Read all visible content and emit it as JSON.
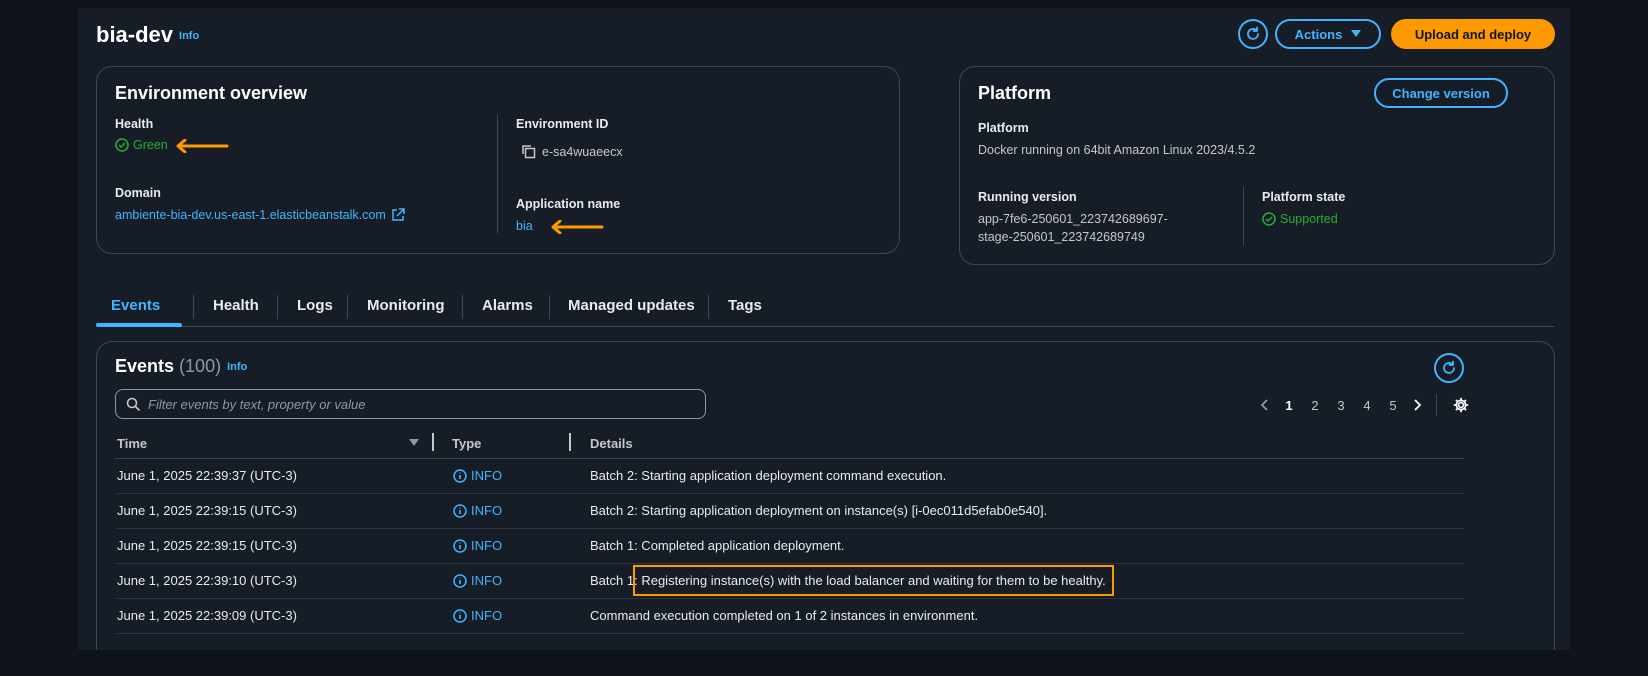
{
  "header": {
    "title": "bia-dev",
    "info": "Info",
    "actions_label": "Actions",
    "upload_label": "Upload and deploy"
  },
  "overview": {
    "title": "Environment overview",
    "health_label": "Health",
    "health_value": "Green",
    "domain_label": "Domain",
    "domain_value": "ambiente-bia-dev.us-east-1.elasticbeanstalk.com",
    "env_id_label": "Environment ID",
    "env_id_value": "e-sa4wuaeecx",
    "app_name_label": "Application name",
    "app_name_value": "bia"
  },
  "platform": {
    "title": "Platform",
    "change_version_label": "Change version",
    "platform_label": "Platform",
    "platform_value": "Docker running on 64bit Amazon Linux 2023/4.5.2",
    "running_version_label": "Running version",
    "running_version_line1": "app-7fe6-250601_223742689697-",
    "running_version_line2": "stage-250601_223742689749",
    "state_label": "Platform state",
    "state_value": "Supported"
  },
  "tabs": [
    "Events",
    "Health",
    "Logs",
    "Monitoring",
    "Alarms",
    "Managed updates",
    "Tags"
  ],
  "events": {
    "title": "Events",
    "count": "(100)",
    "info": "Info",
    "search_placeholder": "Filter events by text, property or value",
    "pages": [
      "1",
      "2",
      "3",
      "4",
      "5"
    ],
    "columns": {
      "time": "Time",
      "type": "Type",
      "details": "Details"
    },
    "rows": [
      {
        "time": "June 1, 2025 22:39:37 (UTC-3)",
        "type": "INFO",
        "details": "Batch 2: Starting application deployment command execution."
      },
      {
        "time": "June 1, 2025 22:39:15 (UTC-3)",
        "type": "INFO",
        "details": "Batch 2: Starting application deployment on instance(s) [i-0ec011d5efab0e540]."
      },
      {
        "time": "June 1, 2025 22:39:15 (UTC-3)",
        "type": "INFO",
        "details": "Batch 1: Completed application deployment."
      },
      {
        "time": "June 1, 2025 22:39:10 (UTC-3)",
        "type": "INFO",
        "details_prefix": "Batch 1:",
        "details_highlight": "Registering instance(s) with the load balancer and waiting for them to be healthy."
      },
      {
        "time": "June 1, 2025 22:39:09 (UTC-3)",
        "type": "INFO",
        "details": "Command execution completed on 1 of 2 instances in environment."
      }
    ]
  },
  "colors": {
    "accent": "#42b4ff",
    "primary": "#ff9900",
    "success": "#29ad32",
    "background": "#161d26"
  }
}
